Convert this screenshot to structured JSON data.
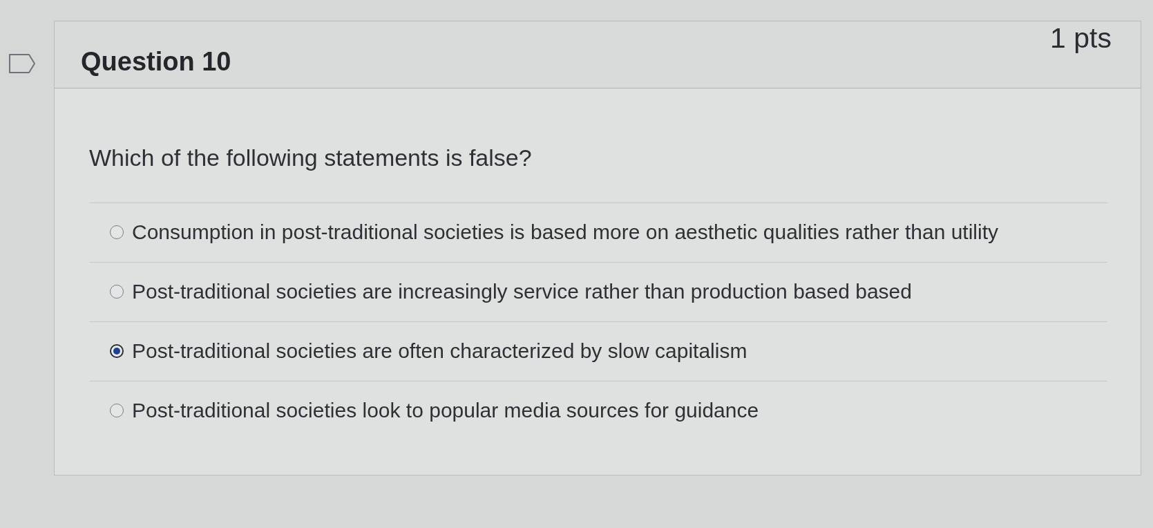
{
  "question": {
    "title": "Question 10",
    "points": "1 pts",
    "prompt": "Which of the following statements is false?",
    "answers": [
      {
        "label": "Consumption in post-traditional societies is based more on aesthetic qualities rather than utility",
        "selected": false
      },
      {
        "label": "Post-traditional societies are increasingly service rather than production based based",
        "selected": false
      },
      {
        "label": "Post-traditional societies are often characterized by slow capitalism",
        "selected": true
      },
      {
        "label": "Post-traditional societies look to popular media sources for guidance",
        "selected": false
      }
    ]
  }
}
